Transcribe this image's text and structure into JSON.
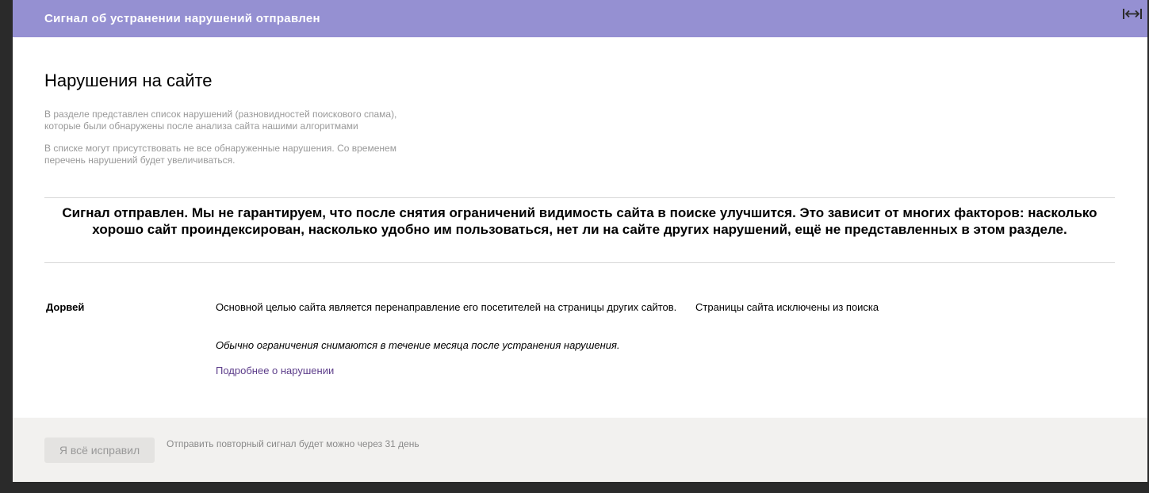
{
  "banner": {
    "title": "Сигнал об устранении нарушений отправлен",
    "color": "#9590d2",
    "expand_icon": "expand-horizontal-icon"
  },
  "page": {
    "title": "Нарушения на сайте",
    "description_1": "В разделе представлен список нарушений (разновидностей поискового спама), которые были обнаружены после анализа сайта нашими алгоритмами",
    "description_2": "В списке могут присутствовать не все обнаруженные нарушения. Со временем перечень нарушений будет увеличиваться."
  },
  "notice": {
    "text": "Сигнал отправлен. Мы не гарантируем, что после снятия ограничений видимость сайта в поиске улучшится. Это зависит от многих факторов: насколько хорошо сайт проиндексирован, насколько удобно им пользоваться, нет ли на сайте других нарушений, ещё не представленных в этом разделе."
  },
  "violation": {
    "name": "Дорвей",
    "description": "Основной целью сайта является перенаправление его посетителей на страницы других сайтов.",
    "note": "Обычно ограничения снимаются в течение месяца после устранения нарушения.",
    "link_label": "Подробнее о нарушении",
    "link_color": "#5c3d8a",
    "status": "Страницы сайта исключены из поиска"
  },
  "footer": {
    "button_label": "Я всё исправил",
    "resend_note": "Отправить повторный сигнал будет можно через 31 день"
  }
}
